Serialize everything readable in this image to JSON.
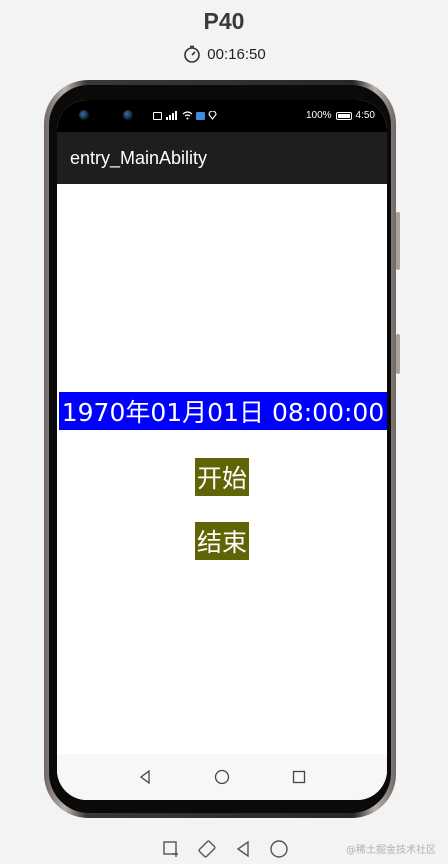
{
  "device": {
    "name": "P40",
    "timer": "00:16:50"
  },
  "status_bar": {
    "battery": "100%",
    "time": "4:50"
  },
  "app": {
    "title": "entry_MainAbility",
    "time_display": "1970年01月01日 08:00:00",
    "start_label": "开始",
    "end_label": "结束"
  },
  "colors": {
    "time_display_bg": "#0000ff",
    "button_bg": "#616404",
    "app_bar_bg": "#1e1e1e"
  },
  "icons": {
    "nav": [
      "back-icon",
      "home-icon",
      "recents-icon"
    ],
    "tools": [
      "screenshot-icon",
      "rotate-icon",
      "back-icon",
      "home-icon"
    ]
  },
  "watermark": "@稀土掘金技术社区"
}
